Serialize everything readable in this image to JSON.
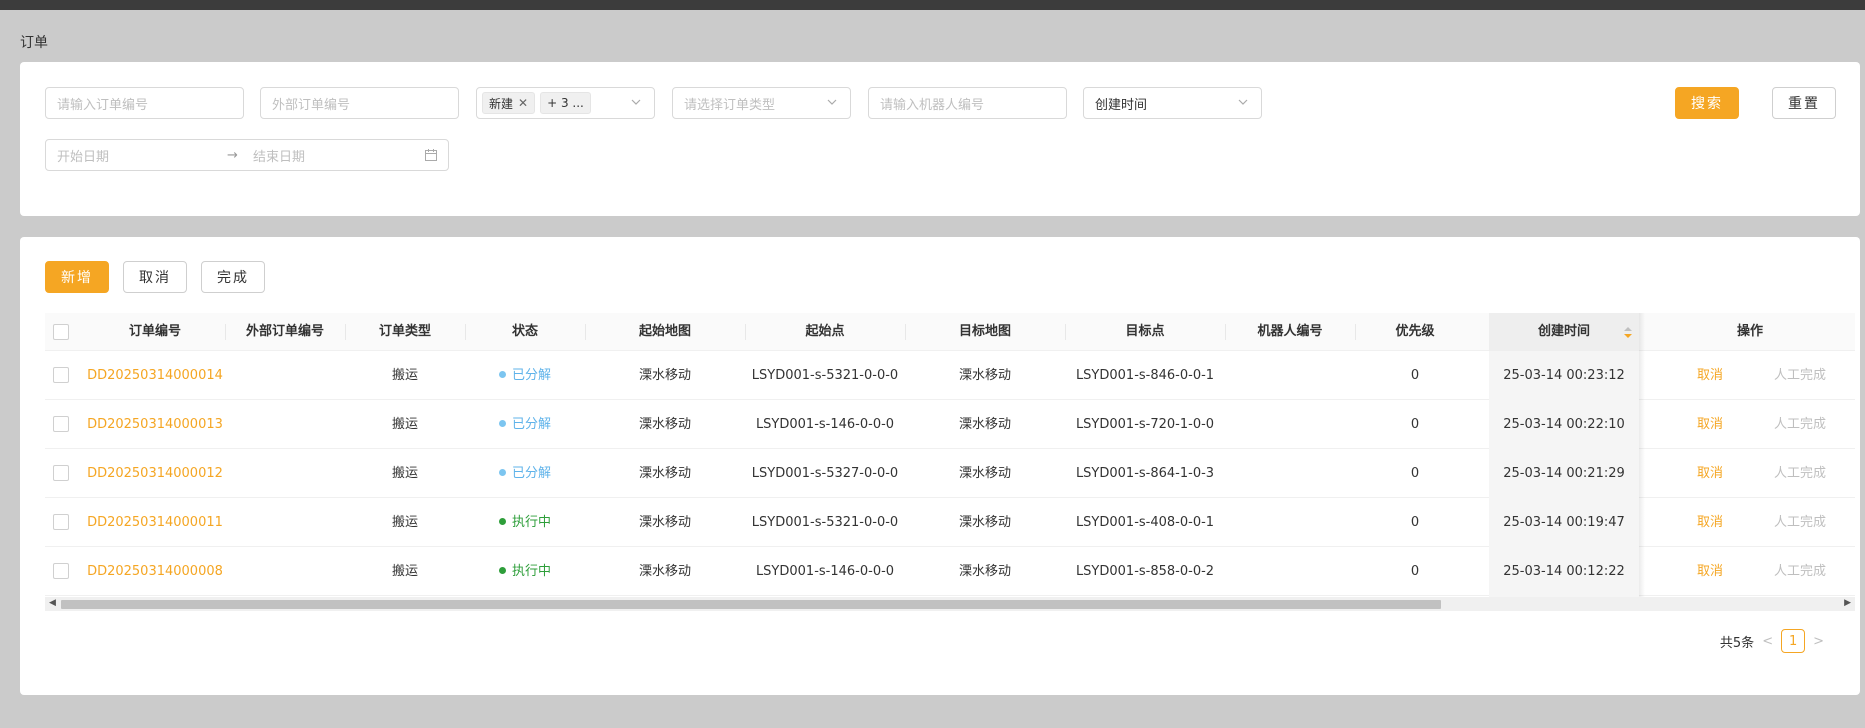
{
  "page_title": "订单",
  "filters": {
    "order_no_placeholder": "请输入订单编号",
    "external_no_placeholder": "外部订单编号",
    "status_tag": "新建",
    "status_more": "+ 3 ...",
    "order_type_placeholder": "请选择订单类型",
    "robot_no_placeholder": "请输入机器人编号",
    "time_field": "创建时间",
    "start_date_placeholder": "开始日期",
    "end_date_placeholder": "结束日期",
    "search_label": "搜索",
    "reset_label": "重置"
  },
  "toolbar": {
    "add_label": "新增",
    "cancel_label": "取消",
    "complete_label": "完成"
  },
  "table": {
    "columns": [
      "订单编号",
      "外部订单编号",
      "订单类型",
      "状态",
      "起始地图",
      "起始点",
      "目标地图",
      "目标点",
      "机器人编号",
      "优先级",
      "创建时间",
      "操作"
    ],
    "rows": [
      {
        "order_no": "DD20250314000014",
        "external_no": "",
        "type": "搬运",
        "status": "已分解",
        "status_color": "#7cc5f0",
        "status_text_color": "#5fb3ea",
        "start_map": "溧水移动",
        "start_point": "LSYD001-s-5321-0-0-0",
        "target_map": "溧水移动",
        "target_point": "LSYD001-s-846-0-0-1",
        "robot": "",
        "priority": "0",
        "created": "25-03-14 00:23:12",
        "action_cancel": "取消",
        "action_manual": "人工完成"
      },
      {
        "order_no": "DD20250314000013",
        "external_no": "",
        "type": "搬运",
        "status": "已分解",
        "status_color": "#7cc5f0",
        "status_text_color": "#5fb3ea",
        "start_map": "溧水移动",
        "start_point": "LSYD001-s-146-0-0-0",
        "target_map": "溧水移动",
        "target_point": "LSYD001-s-720-1-0-0",
        "robot": "",
        "priority": "0",
        "created": "25-03-14 00:22:10",
        "action_cancel": "取消",
        "action_manual": "人工完成"
      },
      {
        "order_no": "DD20250314000012",
        "external_no": "",
        "type": "搬运",
        "status": "已分解",
        "status_color": "#7cc5f0",
        "status_text_color": "#5fb3ea",
        "start_map": "溧水移动",
        "start_point": "LSYD001-s-5327-0-0-0",
        "target_map": "溧水移动",
        "target_point": "LSYD001-s-864-1-0-3",
        "robot": "",
        "priority": "0",
        "created": "25-03-14 00:21:29",
        "action_cancel": "取消",
        "action_manual": "人工完成"
      },
      {
        "order_no": "DD20250314000011",
        "external_no": "",
        "type": "搬运",
        "status": "执行中",
        "status_color": "#2e9e3a",
        "status_text_color": "#2e9e3a",
        "start_map": "溧水移动",
        "start_point": "LSYD001-s-5321-0-0-0",
        "target_map": "溧水移动",
        "target_point": "LSYD001-s-408-0-0-1",
        "robot": "",
        "priority": "0",
        "created": "25-03-14 00:19:47",
        "action_cancel": "取消",
        "action_manual": "人工完成"
      },
      {
        "order_no": "DD20250314000008",
        "external_no": "",
        "type": "搬运",
        "status": "执行中",
        "status_color": "#2e9e3a",
        "status_text_color": "#2e9e3a",
        "start_map": "溧水移动",
        "start_point": "LSYD001-s-146-0-0-0",
        "target_map": "溧水移动",
        "target_point": "LSYD001-s-858-0-0-2",
        "robot": "",
        "priority": "0",
        "created": "25-03-14 00:12:22",
        "action_cancel": "取消",
        "action_manual": "人工完成"
      }
    ]
  },
  "pagination": {
    "total_text": "共5条",
    "current_page": "1"
  },
  "colors": {
    "accent": "#f5a623"
  }
}
